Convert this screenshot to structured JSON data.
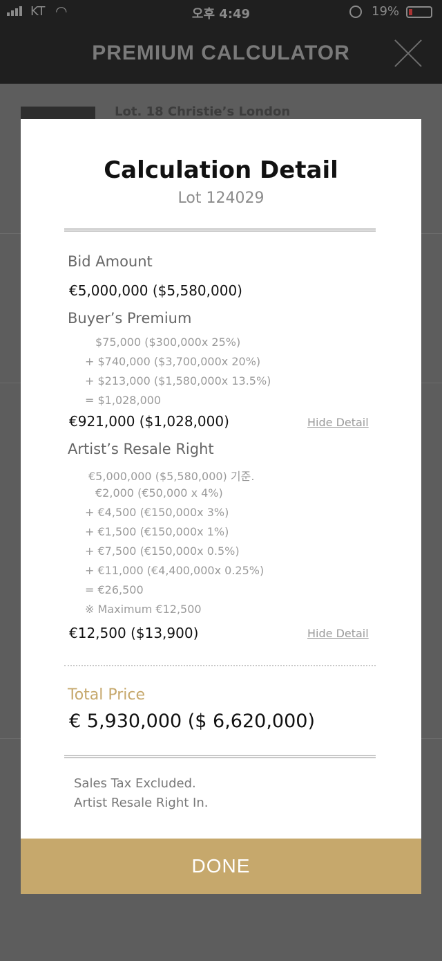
{
  "status_bar": {
    "carrier": "KT",
    "time": "오후 4:49",
    "battery": "19%"
  },
  "header": {
    "title": "PREMIUM CALCULATOR"
  },
  "background": {
    "lot_title": "Lot. 18 Christie’s London"
  },
  "modal": {
    "title": "Calculation Detail",
    "subtitle": "Lot 124029",
    "bid_amount": {
      "label": "Bid Amount",
      "value": "€5,000,000 ($5,580,000)"
    },
    "buyers_premium": {
      "label": "Buyer’s Premium",
      "lines": [
        "$75,000 ($300,000x 25%)",
        "+ $740,000 ($3,700,000x 20%)",
        "+ $213,000 ($1,580,000x 13.5%)",
        "= $1,028,000"
      ],
      "value": "€921,000 ($1,028,000)",
      "toggle_label": "Hide Detail"
    },
    "resale_right": {
      "label": "Artist’s Resale Right",
      "basis": "€5,000,000 ($5,580,000) 기준.",
      "lines": [
        "€2,000 (€50,000 x 4%)",
        "+ €4,500 (€150,000x 3%)",
        "+ €1,500 (€150,000x 1%)",
        "+ €7,500 (€150,000x 0.5%)",
        "+ €11,000 (€4,400,000x 0.25%)",
        "= €26,500",
        "※ Maximum €12,500"
      ],
      "value": "€12,500 ($13,900)",
      "toggle_label": "Hide Detail"
    },
    "total": {
      "label": "Total Price",
      "value": "€ 5,930,000 ($ 6,620,000)"
    },
    "notes": [
      "Sales Tax Excluded.",
      "Artist Resale Right In."
    ],
    "done_label": "DONE"
  },
  "colors": {
    "accent": "#c6a86c",
    "header_bg": "#1f1f1f",
    "overlay_bg": "#5d5d5d"
  }
}
